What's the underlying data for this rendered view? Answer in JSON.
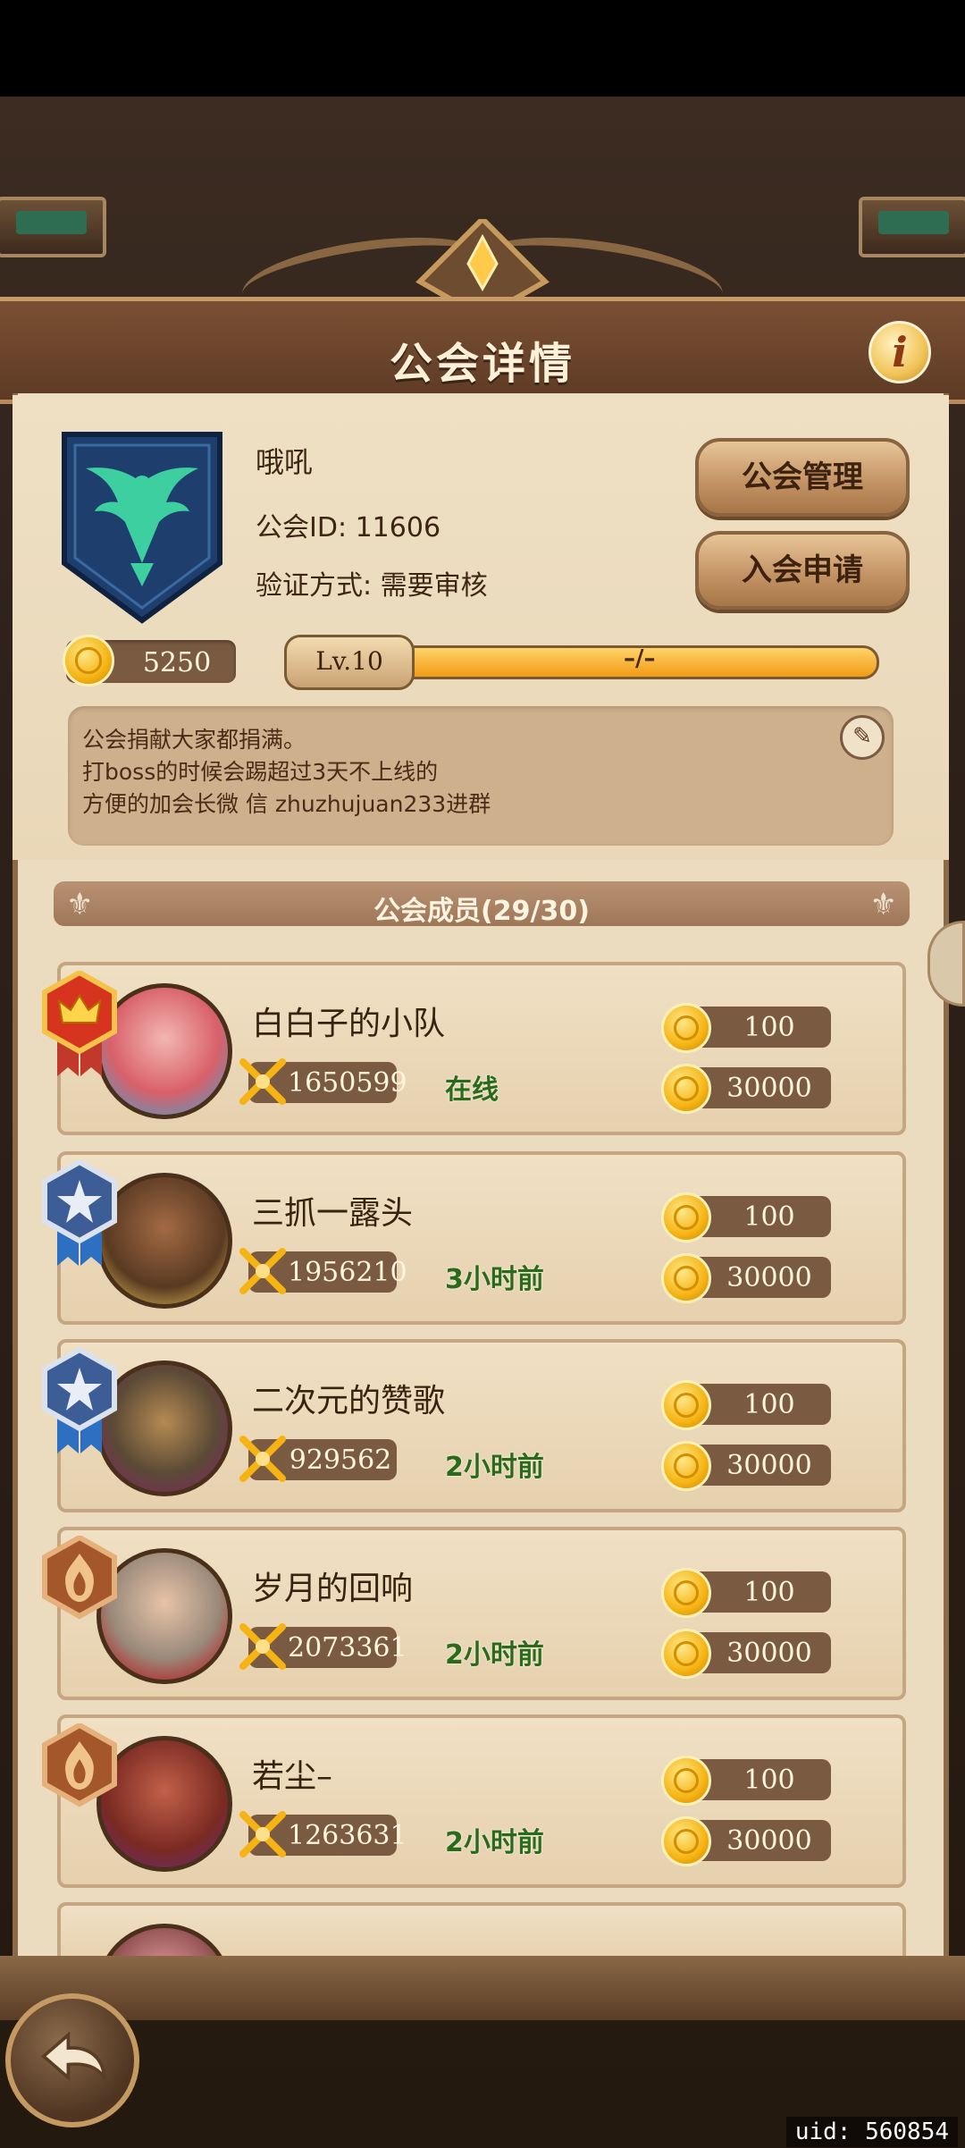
{
  "header": {
    "title": "公会详情",
    "info_icon": "i"
  },
  "guild": {
    "name": "哦吼",
    "id_text": "公会ID: 11606",
    "verify_text": "验证方式: 需要审核",
    "coins": "5250",
    "level": "Lv.10",
    "exp_text": "–/–",
    "exp_fraction": 1.0
  },
  "buttons": {
    "manage": "公会管理",
    "apply": "入会申请"
  },
  "notice": {
    "lines": [
      "公会捐献大家都捐满。",
      "打boss的时候会踢超过3天不上线的",
      "方便的加会长微 信 zhuzhujuan233进群"
    ]
  },
  "members_title": "公会成员(29/30)",
  "members": [
    {
      "name": "白白子的小队",
      "power": "1650599",
      "status": "在线",
      "contrib": "100",
      "honor": "30000",
      "rank_icon": "crown-badge-icon"
    },
    {
      "name": "三抓一露头",
      "power": "1956210",
      "status": "3小时前",
      "contrib": "100",
      "honor": "30000",
      "rank_icon": "star-badge-icon"
    },
    {
      "name": "二次元的赞歌",
      "power": "929562",
      "status": "2小时前",
      "contrib": "100",
      "honor": "30000",
      "rank_icon": "star-badge-icon"
    },
    {
      "name": "岁月的回响",
      "power": "2073361",
      "status": "2小时前",
      "contrib": "100",
      "honor": "30000",
      "rank_icon": "flame-badge-icon"
    },
    {
      "name": "若尘–",
      "power": "1263631",
      "status": "2小时前",
      "contrib": "100",
      "honor": "30000",
      "rank_icon": "flame-badge-icon"
    }
  ],
  "uid": "uid: 560854",
  "colors": {
    "accent_gold": "#f5b413",
    "online_green": "#2a6a18",
    "emblem_blue": "#1e3e6e",
    "emblem_green": "#3ecfa0"
  }
}
